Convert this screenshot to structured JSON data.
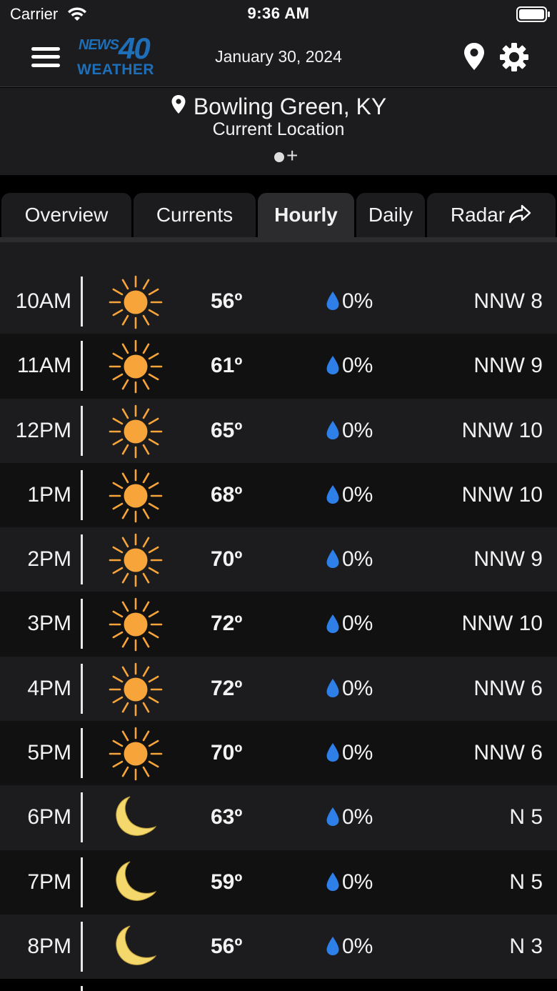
{
  "status_bar": {
    "carrier": "Carrier",
    "time": "9:36 AM"
  },
  "header": {
    "logo": {
      "news": "NEWS",
      "channel": "40",
      "weather": "WEATHER"
    },
    "date": "January 30, 2024"
  },
  "location": {
    "name": "Bowling Green, KY",
    "subtitle": "Current Location",
    "add": "+"
  },
  "tabs": [
    {
      "label": "Overview"
    },
    {
      "label": "Currents"
    },
    {
      "label": "Hourly",
      "active": true
    },
    {
      "label": "Daily"
    },
    {
      "label": "Radar"
    }
  ],
  "hourly": [
    {
      "time": "10AM",
      "icon": "sun-icon",
      "temp": "56º",
      "precip": "0%",
      "wind": "NNW 8"
    },
    {
      "time": "11AM",
      "icon": "sun-icon",
      "temp": "61º",
      "precip": "0%",
      "wind": "NNW 9"
    },
    {
      "time": "12PM",
      "icon": "sun-icon",
      "temp": "65º",
      "precip": "0%",
      "wind": "NNW 10"
    },
    {
      "time": "1PM",
      "icon": "sun-icon",
      "temp": "68º",
      "precip": "0%",
      "wind": "NNW 10"
    },
    {
      "time": "2PM",
      "icon": "sun-icon",
      "temp": "70º",
      "precip": "0%",
      "wind": "NNW 9"
    },
    {
      "time": "3PM",
      "icon": "sun-icon",
      "temp": "72º",
      "precip": "0%",
      "wind": "NNW 10"
    },
    {
      "time": "4PM",
      "icon": "sun-icon",
      "temp": "72º",
      "precip": "0%",
      "wind": "NNW 6"
    },
    {
      "time": "5PM",
      "icon": "sun-icon",
      "temp": "70º",
      "precip": "0%",
      "wind": "NNW 6"
    },
    {
      "time": "6PM",
      "icon": "moon-icon",
      "temp": "63º",
      "precip": "0%",
      "wind": "N 5"
    },
    {
      "time": "7PM",
      "icon": "moon-icon",
      "temp": "59º",
      "precip": "0%",
      "wind": "N 5"
    },
    {
      "time": "8PM",
      "icon": "moon-icon",
      "temp": "56º",
      "precip": "0%",
      "wind": "N 3"
    }
  ],
  "colors": {
    "sun": "#f7a43a",
    "sun_rays": "#f7a43a",
    "moon": "#f5d86b",
    "drop": "#2f7fe8",
    "logo": "#1e6fb8"
  }
}
